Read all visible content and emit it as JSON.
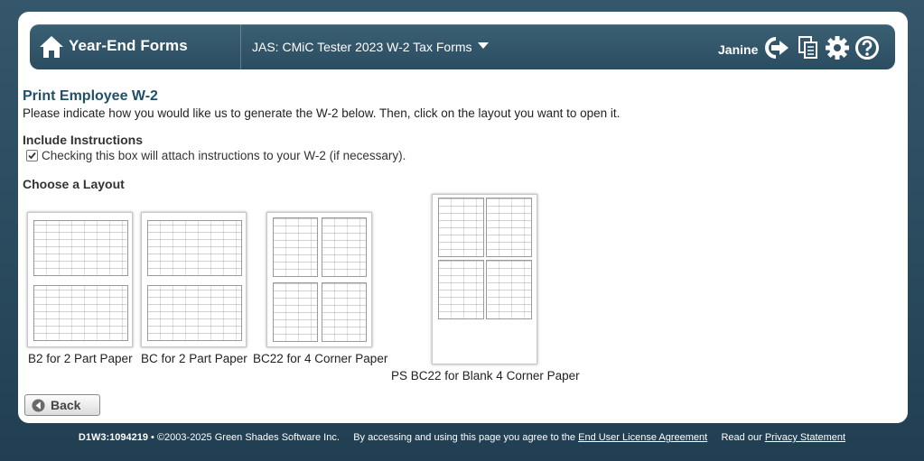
{
  "header": {
    "app_name": "Year-End Forms",
    "company_selector": "JAS: CMiC Tester 2023 W-2 Tax Forms",
    "user_name": "Janine",
    "icons": [
      "home-icon",
      "logout-icon",
      "documents-icon",
      "settings-icon",
      "help-icon"
    ]
  },
  "page": {
    "title": "Print Employee W-2",
    "intro": "Please indicate how you would like us to generate the W-2 below. Then, click on the layout you want to open it.",
    "instructions_heading": "Include Instructions",
    "instructions_checkbox_label": "Checking this box will attach instructions to your W-2 (if necessary).",
    "instructions_checked": true,
    "layout_heading": "Choose a Layout"
  },
  "layouts": [
    {
      "label": "B2 for 2 Part Paper"
    },
    {
      "label": "BC for 2 Part Paper"
    },
    {
      "label": "BC22 for 4 Corner Paper"
    },
    {
      "label": "PS BC22 for Blank 4 Corner Paper"
    }
  ],
  "back_button": "Back",
  "footer": {
    "build": "D1W3:1094219",
    "copyright": "• ©2003-2025 Green Shades Software Inc.",
    "agreement_text": "By accessing and using this page you agree to the",
    "eula_link": "End User License Agreement",
    "privacy_text": "Read our",
    "privacy_link": "Privacy Statement"
  },
  "colors": {
    "background": "#2a4a5e",
    "header_bar": "#33576b",
    "title": "#22506b"
  }
}
